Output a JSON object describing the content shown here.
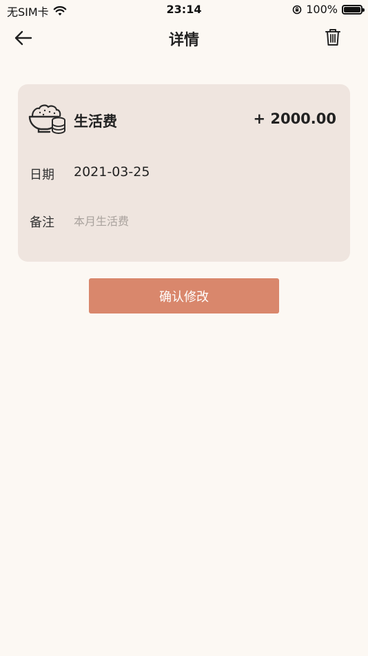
{
  "status_bar": {
    "carrier": "无SIM卡",
    "time": "23:14",
    "battery": "100%",
    "battery_level": 1.0
  },
  "nav": {
    "title": "详情",
    "back_icon": "arrow-left-icon",
    "delete_icon": "trash-icon"
  },
  "record": {
    "category_icon": "rice-bowl-coins-icon",
    "category": "生活费",
    "amount": "+ 2000.00",
    "date_label": "日期",
    "date_value": "2021-03-25",
    "note_label": "备注",
    "note_value": "",
    "note_placeholder": "本月生活费"
  },
  "actions": {
    "confirm_label": "确认修改"
  },
  "colors": {
    "background": "#fcf8f3",
    "card": "#efe5df",
    "accent": "#d9876c"
  }
}
